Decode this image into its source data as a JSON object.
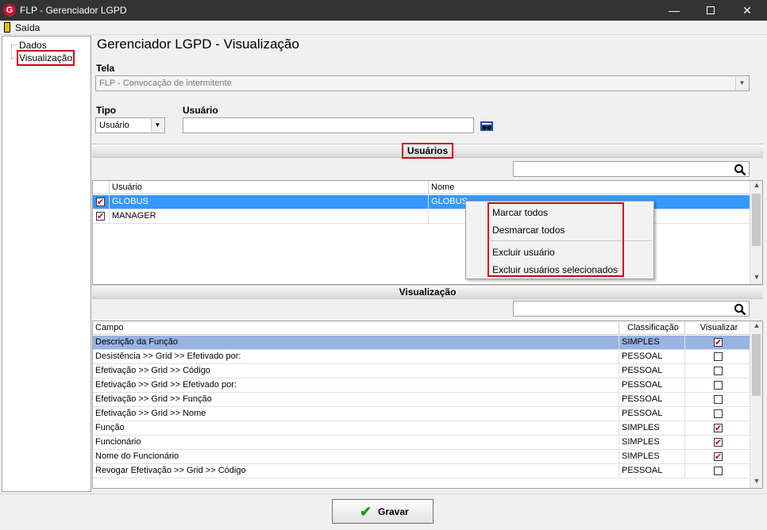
{
  "window": {
    "title": "FLP - Gerenciador LGPD",
    "minimize": "—",
    "close": "✕"
  },
  "menu": {
    "exit_label": "Saída"
  },
  "tree": {
    "items": [
      "Dados",
      "Visualização"
    ]
  },
  "heading": "Gerenciador LGPD - Visualização",
  "tela": {
    "label": "Tela",
    "value": "FLP - Convocação de intermitente"
  },
  "tipo": {
    "label": "Tipo",
    "value": "Usuário"
  },
  "usuario": {
    "label": "Usuário",
    "value": ""
  },
  "users_section": {
    "title": "Usuários",
    "columns": [
      "Usuário",
      "Nome"
    ],
    "rows": [
      {
        "user": "GLOBUS",
        "name": "GLOBUS",
        "checked": true,
        "selected": true
      },
      {
        "user": "MANAGER",
        "name": "",
        "checked": true,
        "selected": false
      }
    ]
  },
  "context_menu": {
    "items": [
      "Marcar todos",
      "Desmarcar todos",
      "Excluir usuário",
      "Excluir usuários selecionados"
    ]
  },
  "view_section": {
    "title": "Visualização",
    "columns": [
      "Campo",
      "Classificação",
      "Visualizar"
    ],
    "rows": [
      {
        "campo": "Descrição da Função",
        "class": "SIMPLES",
        "visualizar": true
      },
      {
        "campo": "Desistência >> Grid >> Efetivado por:",
        "class": "PESSOAL",
        "visualizar": false
      },
      {
        "campo": "Efetivação >> Grid >> Código",
        "class": "PESSOAL",
        "visualizar": false
      },
      {
        "campo": "Efetivação >> Grid >> Efetivado por:",
        "class": "PESSOAL",
        "visualizar": false
      },
      {
        "campo": "Efetivação >> Grid >> Função",
        "class": "PESSOAL",
        "visualizar": false
      },
      {
        "campo": "Efetivação >> Grid >> Nome",
        "class": "PESSOAL",
        "visualizar": false
      },
      {
        "campo": "Função",
        "class": "SIMPLES",
        "visualizar": true
      },
      {
        "campo": "Funcionário",
        "class": "SIMPLES",
        "visualizar": true
      },
      {
        "campo": "Nome do Funcionário",
        "class": "SIMPLES",
        "visualizar": true
      },
      {
        "campo": "Revogar Efetivação >> Grid >> Código",
        "class": "PESSOAL",
        "visualizar": false
      }
    ]
  },
  "save_button": {
    "label": "Gravar"
  },
  "colors": {
    "highlight_outline": "#d0021b",
    "selection": "#3399ff",
    "selection_light": "#99b4e0",
    "check_green": "#1a9b1a"
  }
}
